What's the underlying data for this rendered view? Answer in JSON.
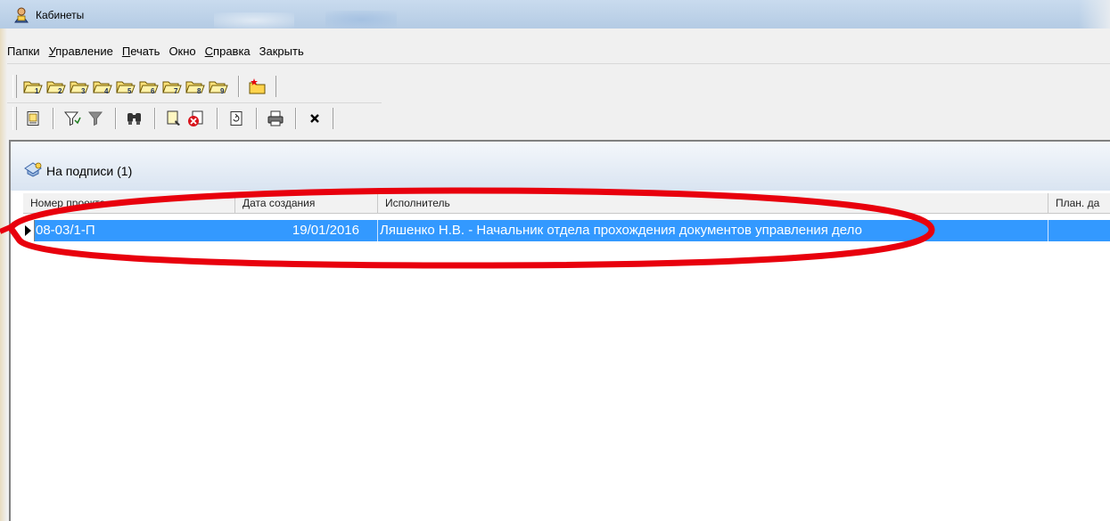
{
  "window": {
    "title": "Кабинеты",
    "icon": "user-cabinet-icon"
  },
  "menu": [
    {
      "label": "Папки",
      "mnemonic": ""
    },
    {
      "label": "Управление",
      "mnemonic": "У"
    },
    {
      "label": "Печать",
      "mnemonic": "П"
    },
    {
      "label": "Окно",
      "mnemonic": ""
    },
    {
      "label": "Справка",
      "mnemonic": "С"
    },
    {
      "label": "Закрыть",
      "mnemonic": ""
    }
  ],
  "folders_toolbar": {
    "folder_buttons": [
      "1",
      "2",
      "3",
      "4",
      "5",
      "6",
      "7",
      "8",
      "9"
    ],
    "new_folder_icon": "new-folder-icon"
  },
  "actions_toolbar": {
    "icons": [
      "document-view-icon",
      "filter-set-icon",
      "filter-icon",
      "find-icon",
      "document-select-icon",
      "document-delete-icon",
      "refresh-icon",
      "print-icon",
      "close-icon"
    ]
  },
  "panel": {
    "title": "На подписи (1)",
    "icon": "folder-sign-icon"
  },
  "grid": {
    "columns": [
      "Номер проекта",
      "Дата создания",
      "Исполнитель",
      "План. да"
    ],
    "rows": [
      {
        "number": "08-03/1-П",
        "date": "19/01/2016",
        "executor": "Ляшенко Н.В. - Начальник отдела прохождения документов управления дело",
        "plan": ""
      }
    ]
  },
  "colors": {
    "selection": "#3399ff",
    "annotation": "#e8000d"
  }
}
